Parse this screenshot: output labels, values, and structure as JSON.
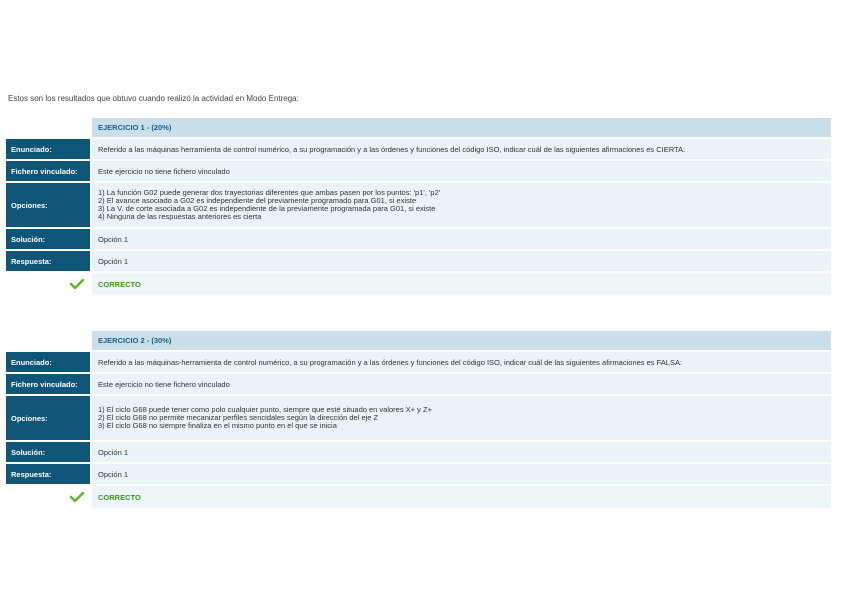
{
  "intro": "Estos son los resultados que obtuvo cuando realizó la actividad en Modo Entrega:",
  "labels": {
    "enunciado": "Enunciado:",
    "fichero": "Fichero vinculado:",
    "opciones": "Opciones:",
    "solucion": "Solución:",
    "respuesta": "Respuesta:"
  },
  "exercises": [
    {
      "title": "EJERCICIO 1 - (20%)",
      "enunciado": "Referido a las máquinas herramienta de control numérico, a su programación y a las órdenes y funciones del código ISO, indicar cuál de las siguientes afirmaciones es CIERTA:",
      "fichero": "Este ejercicio no tiene fichero vinculado",
      "opciones": [
        "1) La función G02 puede generar dos trayectorias diferentes que ambas pasen por los puntos: 'p1', 'p2'",
        "2) El avance asociado a G02 es independiente del previamente programado para G01, si existe",
        "3) La V. de corte asociada a G02 es independiente de la previamente programada para G01, si existe",
        "4) Ninguna de las respuestas anteriores es cierta"
      ],
      "solucion": "Opción 1",
      "respuesta": "Opción 1",
      "resultado": "CORRECTO"
    },
    {
      "title": "EJERCICIO 2 - (30%)",
      "enunciado": "Referido a las máquinas-herramienta de control numérico, a su programación y a las órdenes y funciones del código ISO, indicar cuál de las siguientes afirmaciones es FALSA:",
      "fichero": "Este ejercicio no tiene fichero vinculado",
      "opciones": [
        "1) El ciclo G68 puede tener como polo cualquier punto, siempre que esté situado en valores X+ y Z+",
        "2) El ciclo G68 no permite mecanizar perfiles sencidales según la dirección del eje Z",
        "3) El ciclo G68 no siempre finaliza en el mismo punto en el que se inicia"
      ],
      "solucion": "Opción 1",
      "respuesta": "Opción 1",
      "resultado": "CORRECTO"
    }
  ],
  "colors": {
    "label_bg": "#0e5577",
    "header_bg": "#c9e0ec",
    "value_bg": "#eaf3f8",
    "correct": "#3a9a1a"
  },
  "icons": {
    "result": "checkmark-icon"
  }
}
